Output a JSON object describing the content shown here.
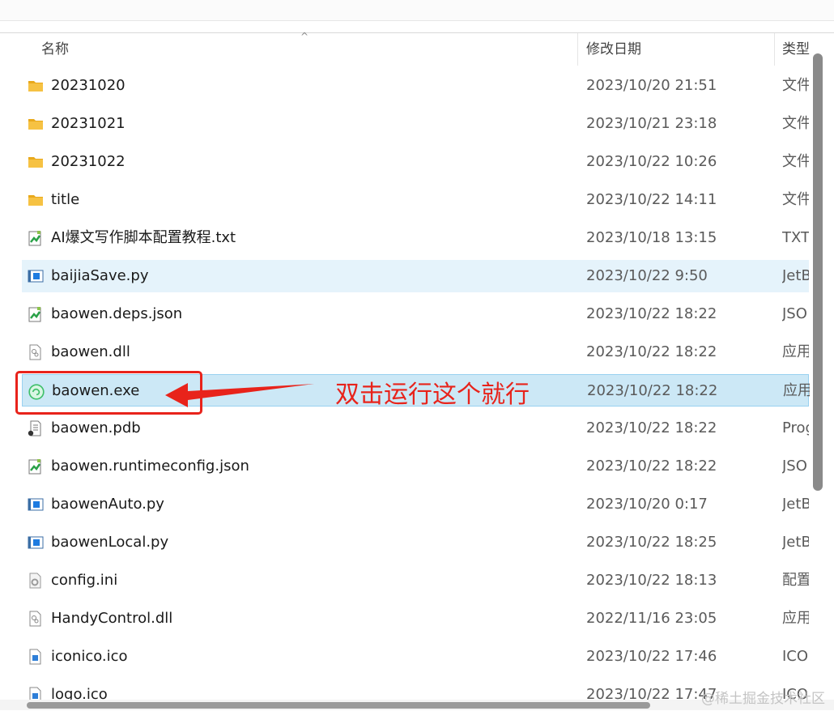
{
  "header": {
    "name_label": "名称",
    "date_label": "修改日期",
    "type_label": "类型"
  },
  "files": [
    {
      "name": "20231020",
      "date": "2023/10/20 21:51",
      "type": "文件",
      "icon": "folder-icon"
    },
    {
      "name": "20231021",
      "date": "2023/10/21 23:18",
      "type": "文件",
      "icon": "folder-icon"
    },
    {
      "name": "20231022",
      "date": "2023/10/22 10:26",
      "type": "文件",
      "icon": "folder-icon"
    },
    {
      "name": "title",
      "date": "2023/10/22 14:11",
      "type": "文件",
      "icon": "folder-icon"
    },
    {
      "name": "AI爆文写作脚本配置教程.txt",
      "date": "2023/10/18 13:15",
      "type": "TXT",
      "icon": "text-file-icon"
    },
    {
      "name": "baijiaSave.py",
      "date": "2023/10/22 9:50",
      "type": "JetB",
      "icon": "python-file-icon"
    },
    {
      "name": "baowen.deps.json",
      "date": "2023/10/22 18:22",
      "type": "JSO",
      "icon": "json-file-icon"
    },
    {
      "name": "baowen.dll",
      "date": "2023/10/22 18:22",
      "type": "应用",
      "icon": "dll-file-icon"
    },
    {
      "name": "baowen.exe",
      "date": "2023/10/22 18:22",
      "type": "应用",
      "icon": "exe-app-icon"
    },
    {
      "name": "baowen.pdb",
      "date": "2023/10/22 18:22",
      "type": "Prog",
      "icon": "pdb-file-icon"
    },
    {
      "name": "baowen.runtimeconfig.json",
      "date": "2023/10/22 18:22",
      "type": "JSO",
      "icon": "json-file-icon"
    },
    {
      "name": "baowenAuto.py",
      "date": "2023/10/20 0:17",
      "type": "JetB",
      "icon": "python-file-icon"
    },
    {
      "name": "baowenLocal.py",
      "date": "2023/10/22 18:25",
      "type": "JetB",
      "icon": "python-file-icon"
    },
    {
      "name": "config.ini",
      "date": "2023/10/22 18:13",
      "type": "配置",
      "icon": "ini-file-icon"
    },
    {
      "name": "HandyControl.dll",
      "date": "2022/11/16 23:05",
      "type": "应用",
      "icon": "dll-file-icon"
    },
    {
      "name": "iconico.ico",
      "date": "2023/10/22 17:46",
      "type": "ICO",
      "icon": "ico-file-icon"
    },
    {
      "name": "logo.ico",
      "date": "2023/10/22 17:47",
      "type": "ICO",
      "icon": "ico-file-icon"
    }
  ],
  "annotation": {
    "text": "双击运行这个就行",
    "color": "#e8231b"
  },
  "watermark": "@稀土掘金技术社区",
  "colors": {
    "hover_row": "#e5f3fb",
    "selected_row": "#cce8f6",
    "folder": "#f6c243"
  }
}
